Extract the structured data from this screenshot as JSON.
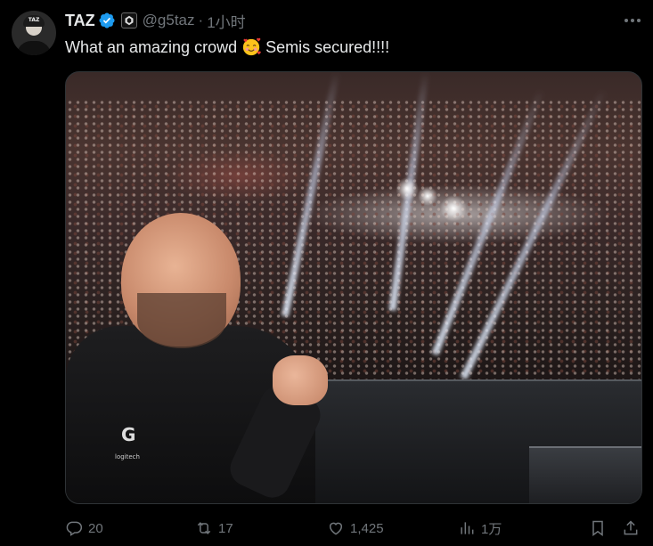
{
  "author": {
    "name": "TAZ",
    "handle": "@g5taz",
    "separator": "·",
    "time": "1小时",
    "avatar_cap_text": "TAZ"
  },
  "tweet": {
    "text_before": "What an amazing crowd",
    "text_after": "Semis secured!!!!",
    "emoji": "smiling-face-with-hearts"
  },
  "media": {
    "logo_letter": "G",
    "logo_text": "logitech"
  },
  "actions": {
    "replies": "20",
    "retweets": "17",
    "likes": "1,425",
    "views": "1万"
  },
  "colors": {
    "background": "#000000",
    "text": "#e7e9ea",
    "muted": "#71767b",
    "verified": "#1d9bf0",
    "border": "#2f3336"
  },
  "icons": {
    "verified": "verified-badge-icon",
    "org": "affiliate-badge-icon",
    "more": "more-dots-icon",
    "reply": "reply-icon",
    "retweet": "retweet-icon",
    "like": "heart-icon",
    "views": "analytics-icon",
    "bookmark": "bookmark-icon",
    "share": "share-icon"
  }
}
